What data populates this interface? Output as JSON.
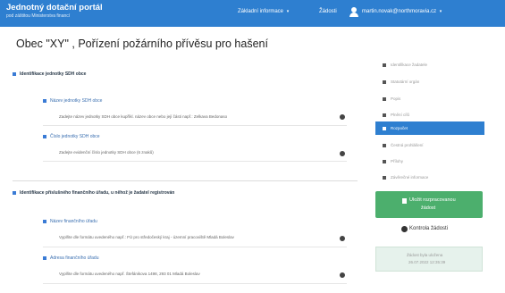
{
  "navbar": {
    "title": "Jednotný dotační portál",
    "subtitle": "pod záštitou Ministerstva financí",
    "menu_info": "Základní informace",
    "menu_requests": "Žádosti",
    "user_email": "martin.novak@northmoravia.cz",
    "caret": "▾"
  },
  "page": {
    "title": "Obec \"XY\" , Pořízení požárního přívěsu pro hašení"
  },
  "sections": [
    {
      "heading": "Identifikace jednotky SDH obce",
      "items": [
        {
          "label": "Název jednotky SDH obce",
          "value": "Zadejte název jednotky SDH obce kupříkl. název obce nebo její části např.: Zelkava Bedonaso"
        },
        {
          "label": "Číslo jednotky SDH obce",
          "value": "Zadejte evidenční číslo jednotky SDH obce (6 znaků)"
        }
      ]
    },
    {
      "heading": "Identifikace příslušného finančního úřadu, u něhož je žadatel registrován",
      "items": [
        {
          "label": "Název finančního úřadu",
          "value": "Vyplňte dle formátu uvedeného např.: FÚ pro středočeský kraj - územní pracoviště Mladá Boleslav"
        },
        {
          "label": "Adresa finančního úřadu",
          "value": "Vyplňte dle formátu uvedeného např. Štefánikova 1498, 293 01 Mladá Boleslav"
        }
      ]
    }
  ],
  "sidebar": {
    "items": [
      {
        "label": "Identifikace žadatele"
      },
      {
        "label": "Statutární orgán"
      },
      {
        "label": "Popis"
      },
      {
        "label": "Plnění cílů"
      },
      {
        "label": "Rozpočet"
      },
      {
        "label": "Čestná prohlášení"
      },
      {
        "label": "Přílohy"
      },
      {
        "label": "Závěrečné informace"
      }
    ],
    "active_index": 4
  },
  "actions": {
    "save_label_line1": "Uložit rozpracovanou",
    "save_label_line2": "žádost",
    "check_label": "Kontrola žádosti",
    "status_line1": "Žádost byla uložena",
    "status_line2": "26.07.2022 12:35:39"
  },
  "colors": {
    "brand": "#2e7fd0",
    "success": "#4caf6d",
    "status_bg": "#e6f2ec"
  },
  "icons": {
    "user": "user-icon",
    "info": "info-circle-icon",
    "save": "save-icon",
    "check": "check-circle-icon"
  }
}
